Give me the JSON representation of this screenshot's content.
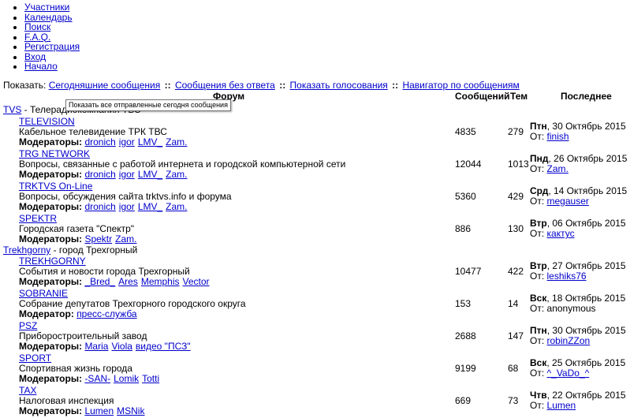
{
  "nav": [
    "Участники",
    "Календарь",
    "Поиск",
    "F.A.Q.",
    "Регистрация",
    "Вход",
    "Начало"
  ],
  "show": {
    "label": "Показать:",
    "links": [
      "Сегодняшние сообщения",
      "Сообщения без ответа",
      "Показать голосования",
      "Навигатор по сообщениям"
    ],
    "separator": "::"
  },
  "tooltip": "Показать все отправленные сегодня сообщения",
  "headers": {
    "forum": "Форум",
    "posts": "Сообщений",
    "topics": "Тем",
    "last": "Последнее"
  },
  "categories": [
    {
      "name": "TVS",
      "desc": " - Телерадиокомпания ТВС",
      "forums": [
        {
          "name": "TELEVISION",
          "desc": "Кабельное телевидение ТРК ТВС",
          "mods_label": "Модераторы:",
          "mods": [
            "dronich",
            "igor",
            "LMV_",
            "Zam."
          ],
          "posts": "4835",
          "topics": "279",
          "last_day": "Птн",
          "last_date": ", 30 Октябрь 2015",
          "from_label": "От:",
          "last_user": "finish",
          "last_user_link": true
        },
        {
          "name": "TRG NETWORK",
          "desc": "Вопросы, связанные с работой интернета и городской компьютерной сети",
          "mods_label": "Модераторы:",
          "mods": [
            "dronich",
            "igor",
            "LMV_",
            "Zam."
          ],
          "posts": "12044",
          "topics": "1013",
          "last_day": "Пнд",
          "last_date": ", 26 Октябрь 2015",
          "from_label": "От:",
          "last_user": "Zam.",
          "last_user_link": true
        },
        {
          "name": "TRKTVS On-Line",
          "desc": "Вопросы, обсуждения сайта trktvs.info и форума",
          "mods_label": "Модераторы:",
          "mods": [
            "dronich",
            "igor",
            "LMV_",
            "Zam."
          ],
          "posts": "5360",
          "topics": "429",
          "last_day": "Срд",
          "last_date": ", 14 Октябрь 2015",
          "from_label": "От:",
          "last_user": "megauser",
          "last_user_link": true
        },
        {
          "name": "SPEKTR",
          "desc": "Городская газета \"Спектр\"",
          "mods_label": "Модераторы:",
          "mods": [
            "Spektr",
            "Zam."
          ],
          "posts": "886",
          "topics": "130",
          "last_day": "Втр",
          "last_date": ", 06 Октябрь 2015",
          "from_label": "От:",
          "last_user": "кактус",
          "last_user_link": true
        }
      ]
    },
    {
      "name": "Trekhgorny",
      "desc": " - город Трехгорный",
      "forums": [
        {
          "name": "TREKHGORNY",
          "desc": "События и новости города Трехгорный",
          "mods_label": "Модераторы:",
          "mods": [
            "_Bred_",
            "Ares",
            "Memphis",
            "Vector"
          ],
          "posts": "10477",
          "topics": "422",
          "last_day": "Втр",
          "last_date": ", 27 Октябрь 2015",
          "from_label": "От:",
          "last_user": "leshiks76",
          "last_user_link": true
        },
        {
          "name": "SOBRANIE",
          "desc": "Собрание депутатов Трехгорного городского округа",
          "mods_label": "Модератор:",
          "mods": [
            "пресс-служба"
          ],
          "posts": "153",
          "topics": "14",
          "last_day": "Вск",
          "last_date": ", 18 Октябрь 2015",
          "from_label": "От:",
          "last_user": "anonymous",
          "last_user_link": false
        },
        {
          "name": "PSZ",
          "desc": "Приборостроительный завод",
          "mods_label": "Модераторы:",
          "mods": [
            "Maria",
            "Viola",
            "видео \"ПСЗ\""
          ],
          "posts": "2688",
          "topics": "147",
          "last_day": "Птн",
          "last_date": ", 30 Октябрь 2015",
          "from_label": "От:",
          "last_user": "robinZZon",
          "last_user_link": true
        },
        {
          "name": "SPORT",
          "desc": "Спортивная жизнь города",
          "mods_label": "Модераторы:",
          "mods": [
            "-SAN-",
            "Lomik",
            "Totti"
          ],
          "posts": "9199",
          "topics": "68",
          "last_day": "Вск",
          "last_date": ", 25 Октябрь 2015",
          "from_label": "От:",
          "last_user": "^_VaDo_^",
          "last_user_link": true
        },
        {
          "name": "TAX",
          "desc": "Налоговая инспекция",
          "mods_label": "Модераторы:",
          "mods": [
            "Lumen",
            "MSNik"
          ],
          "posts": "669",
          "topics": "73",
          "last_day": "Чтв",
          "last_date": ", 22 Октябрь 2015",
          "from_label": "От:",
          "last_user": "Lumen",
          "last_user_link": true
        }
      ]
    }
  ]
}
